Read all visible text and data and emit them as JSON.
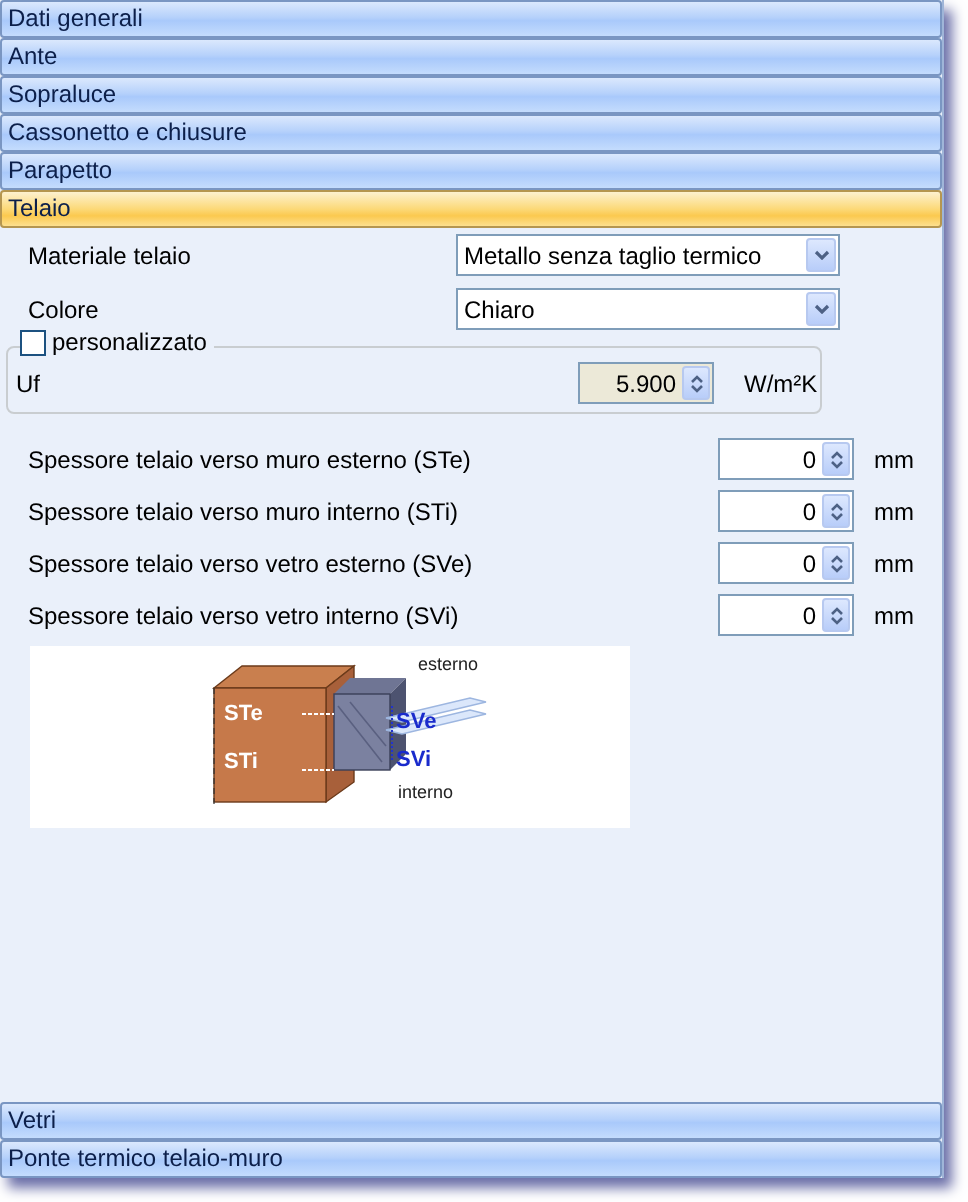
{
  "sections": [
    {
      "label": "Dati generali",
      "expanded": false
    },
    {
      "label": "Ante",
      "expanded": false
    },
    {
      "label": "Sopraluce",
      "expanded": false
    },
    {
      "label": "Cassonetto e chiusure",
      "expanded": false
    },
    {
      "label": "Parapetto",
      "expanded": false
    },
    {
      "label": "Telaio",
      "expanded": true
    },
    {
      "label": "Vetri",
      "expanded": false
    },
    {
      "label": "Ponte termico telaio-muro",
      "expanded": false
    }
  ],
  "telaio": {
    "combos": [
      {
        "label": "Materiale telaio",
        "value": "Metallo senza taglio termico"
      },
      {
        "label": "Colore",
        "value": "Chiaro"
      }
    ],
    "custom": {
      "label": "personalizzato",
      "checked": false,
      "field": {
        "label": "Uf",
        "value": "5.900",
        "unit": "W/m²K",
        "disabled": true
      }
    },
    "thicknesses": [
      {
        "label": "Spessore telaio verso muro esterno (STe)",
        "value": "0",
        "unit": "mm"
      },
      {
        "label": "Spessore telaio verso muro interno (STi)",
        "value": "0",
        "unit": "mm"
      },
      {
        "label": "Spessore telaio verso vetro esterno (SVe)",
        "value": "0",
        "unit": "mm"
      },
      {
        "label": "Spessore telaio verso vetro interno (SVi)",
        "value": "0",
        "unit": "mm"
      }
    ],
    "diagram": {
      "outside": "esterno",
      "inside": "interno",
      "ste": "STe",
      "sti": "STi",
      "sve": "SVe",
      "svi": "SVi"
    }
  }
}
